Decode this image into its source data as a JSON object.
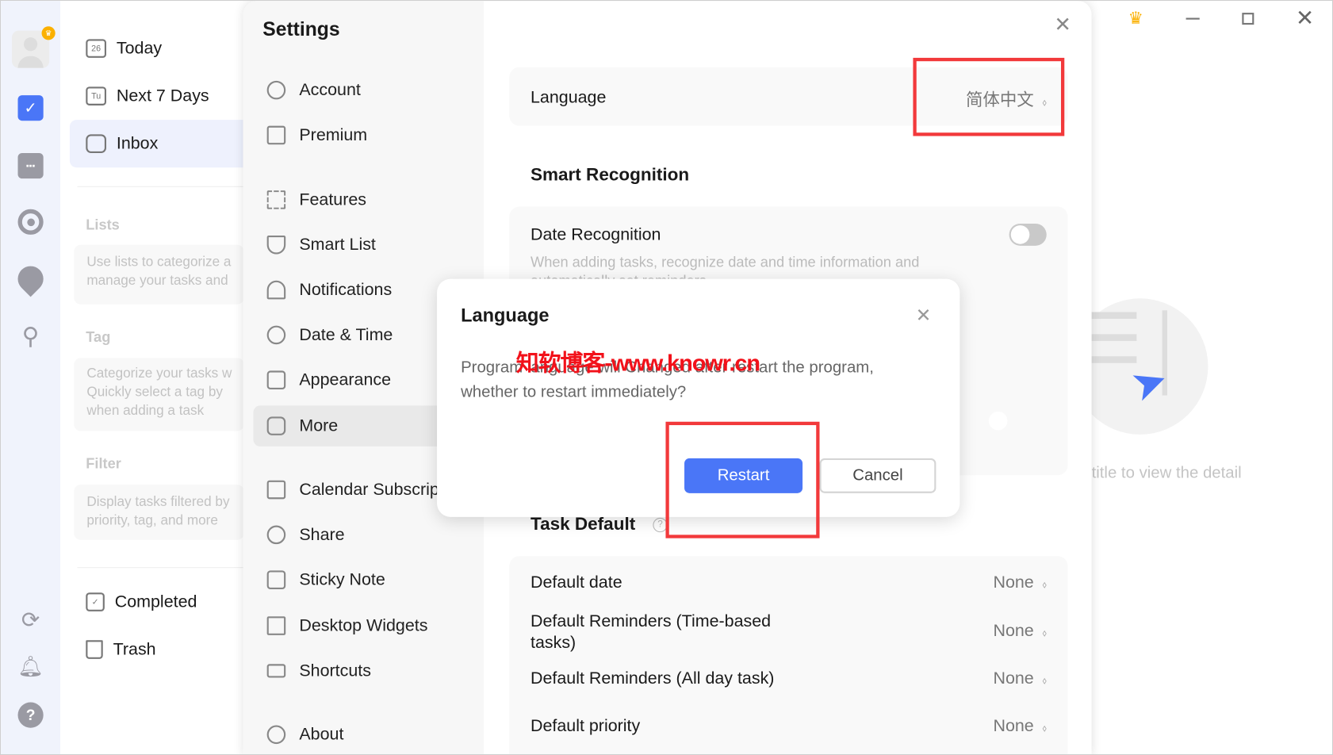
{
  "window": {
    "controls": [
      "crown-icon",
      "minimize-icon",
      "maximize-icon",
      "close-icon"
    ],
    "border_color": "#cfcfcf"
  },
  "rail": {
    "icons": [
      "avatar",
      "task-check-icon",
      "calendar-icon",
      "focus-icon",
      "habit-clock-icon",
      "search-icon"
    ],
    "bottom_icons": [
      "sync-icon",
      "bell-icon",
      "help-icon"
    ],
    "accent": "#4a76f7"
  },
  "lists_pane": {
    "items": [
      {
        "icon_text": "26",
        "label": "Today"
      },
      {
        "icon_text": "Tu",
        "label": "Next 7 Days"
      },
      {
        "label": "Inbox"
      }
    ],
    "sections": [
      {
        "title": "Lists",
        "hint": [
          "Use lists to categorize a",
          "manage your tasks and"
        ]
      },
      {
        "title": "Tag",
        "hint": [
          "Categorize your tasks w",
          "Quickly select a tag by",
          "when adding a task"
        ]
      },
      {
        "title": "Filter",
        "hint": [
          "Display tasks filtered by",
          "priority, tag, and more"
        ]
      }
    ],
    "bottom": [
      {
        "label": "Completed"
      },
      {
        "label": "Trash"
      }
    ]
  },
  "settings": {
    "title": "Settings",
    "nav": [
      "Account",
      "Premium",
      "Features",
      "Smart List",
      "Notifications",
      "Date & Time",
      "Appearance",
      "More",
      "Calendar Subscription",
      "Share",
      "Sticky Note",
      "Desktop Widgets",
      "Shortcuts",
      "About"
    ],
    "active": "More",
    "language": {
      "label": "Language",
      "value": "简体中文"
    },
    "smart_recognition": {
      "title": "Smart Recognition",
      "date_recognition": {
        "label": "Date Recognition",
        "description": "When adding tasks, recognize date and time information and",
        "description2": "automatically set reminders",
        "enabled": false
      },
      "second_toggle_enabled": true
    },
    "task_default": {
      "title": "Task Default",
      "help": "?",
      "rows": [
        {
          "label": "Default date",
          "value": "None"
        },
        {
          "label": "Default Reminders (Time-based",
          "label2": "tasks)",
          "value": "None"
        },
        {
          "label": "Default Reminders (All day task)",
          "value": "None"
        },
        {
          "label": "Default priority",
          "value": "None"
        }
      ]
    }
  },
  "detail_placeholder": {
    "text": "title to view the detail"
  },
  "dialog": {
    "title": "Language",
    "message1": "Program language will Changed after restart the program,",
    "message2": "whether to restart immediately?",
    "restart": "Restart",
    "cancel": "Cancel",
    "primary_color": "#4a76f7"
  },
  "watermark": "知软博客-www.knowr.cn",
  "annotation_color": "#f2393b"
}
